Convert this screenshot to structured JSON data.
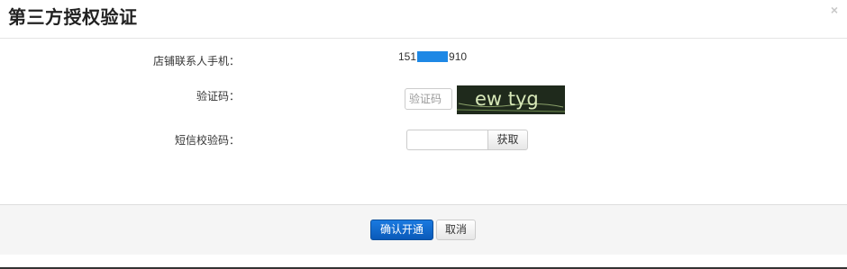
{
  "dialog": {
    "title": "第三方授权验证",
    "close_symbol": "×"
  },
  "form": {
    "phone": {
      "label": "店铺联系人手机：",
      "prefix": "151",
      "suffix": "910"
    },
    "captcha": {
      "label": "验证码：",
      "placeholder": "验证码",
      "image_text": "ew tyg"
    },
    "sms": {
      "label": "短信校验码：",
      "value": "",
      "get_button": "获取"
    }
  },
  "footer": {
    "confirm_label": "确认开通",
    "cancel_label": "取消"
  },
  "colors": {
    "primary": "#0a6ad4",
    "redaction": "#1e88e5",
    "captcha_bg": "#1f2a1c",
    "captcha_text": "#cfe3b0"
  }
}
